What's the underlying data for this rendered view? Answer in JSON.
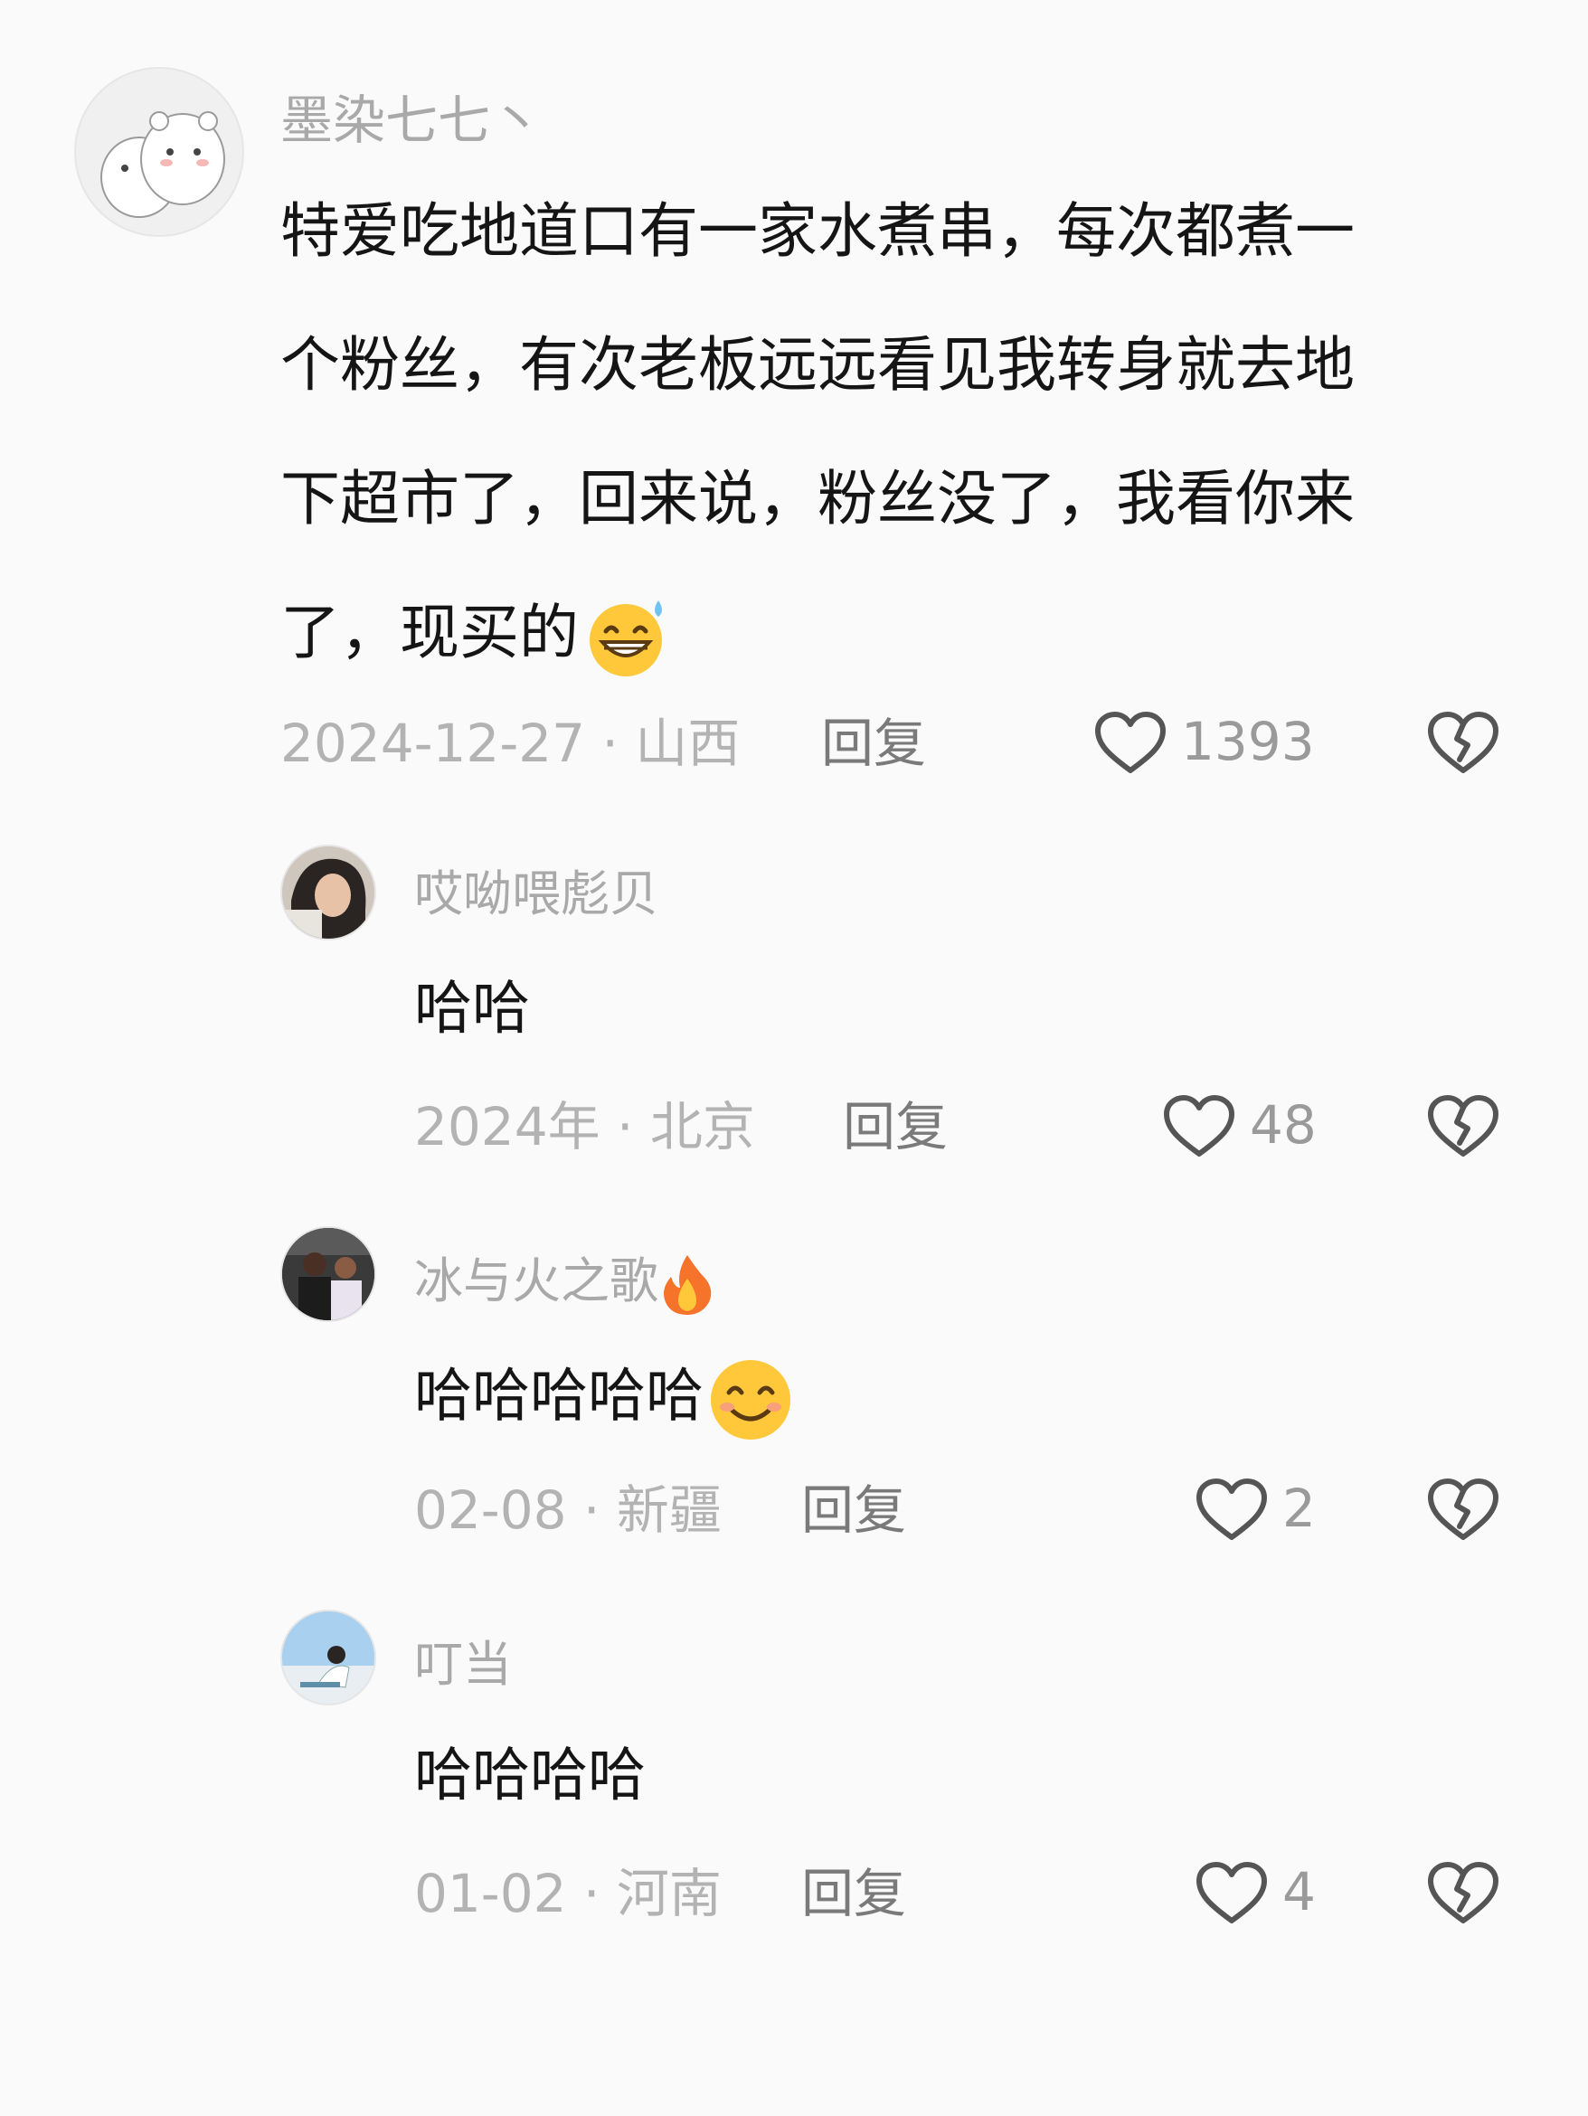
{
  "comments": [
    {
      "username": "墨染七七丶",
      "content_lines": [
        "特爱吃地道口有一家水煮串，每次都煮一",
        "个粉丝，有次老板远远看见我转身就去地",
        "下超市了，回来说，粉丝没了，我看你来",
        "了，现买的"
      ],
      "content_emoji": "grinning-sweat-emoji",
      "date_location": "2024-12-27 · 山西",
      "reply_label": "回复",
      "likes": "1393",
      "avatar_icon": "cartoon-bears-avatar"
    }
  ],
  "replies": [
    {
      "username": "哎呦喂彪贝",
      "text": "哈哈",
      "date_location": "2024年 · 北京",
      "reply_label": "回复",
      "likes": "48",
      "avatar_icon": "woman-portrait-avatar"
    },
    {
      "username": "冰与火之歌",
      "username_emoji": "fire-emoji",
      "text": "哈哈哈哈哈",
      "text_emoji": "smiling-face-emoji",
      "date_location": "02-08 · 新疆",
      "reply_label": "回复",
      "likes": "2",
      "avatar_icon": "two-people-avatar"
    },
    {
      "username": "叮当",
      "text": "哈哈哈哈",
      "date_location": "01-02 · 河南",
      "reply_label": "回复",
      "likes": "4",
      "avatar_icon": "girl-outdoor-avatar"
    }
  ],
  "icons": {
    "like": "heart-outline-icon",
    "dislike": "broken-heart-icon"
  },
  "colors": {
    "background": "#fafafa",
    "text": "#151515",
    "secondary": "#a9a9a9"
  }
}
